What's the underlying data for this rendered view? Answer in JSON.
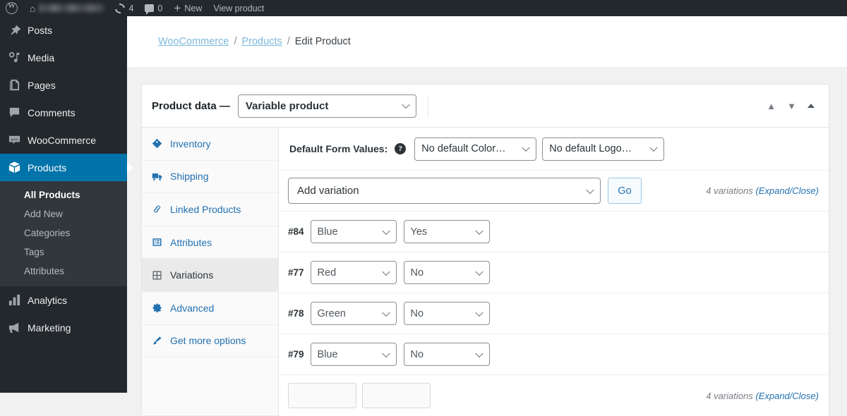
{
  "adminbar": {
    "wp_logo": "wordpress-logo-icon",
    "site_name": "",
    "updates_count": "4",
    "comments_count": "0",
    "new_label": "New",
    "view_product_label": "View product"
  },
  "sidebar": {
    "items": [
      {
        "label": "Posts",
        "icon": "pin-icon",
        "current": false
      },
      {
        "label": "Media",
        "icon": "media-icon",
        "current": false
      },
      {
        "label": "Pages",
        "icon": "pages-icon",
        "current": false
      },
      {
        "label": "Comments",
        "icon": "comment-icon",
        "current": false
      },
      {
        "label": "WooCommerce",
        "icon": "woocommerce-icon",
        "current": false
      },
      {
        "label": "Products",
        "icon": "products-box-icon",
        "current": true
      },
      {
        "label": "Analytics",
        "icon": "chart-bar-icon",
        "current": false
      },
      {
        "label": "Marketing",
        "icon": "megaphone-icon",
        "current": false
      }
    ],
    "products_submenu": [
      {
        "label": "All Products",
        "current": true
      },
      {
        "label": "Add New",
        "current": false
      },
      {
        "label": "Categories",
        "current": false
      },
      {
        "label": "Tags",
        "current": false
      },
      {
        "label": "Attributes",
        "current": false
      }
    ]
  },
  "breadcrumb": {
    "root": "WooCommerce",
    "sep": "/",
    "parent": "Products",
    "current": "Edit Product"
  },
  "panel": {
    "title": "Product data —",
    "product_type": "Variable product",
    "move_up_icon": "chevron-up-icon",
    "move_down_icon": "chevron-down-icon",
    "toggle_icon": "toggle-triangle-icon"
  },
  "tabs": [
    {
      "label": "Inventory",
      "icon": "inventory-tag-icon",
      "active": false
    },
    {
      "label": "Shipping",
      "icon": "truck-icon",
      "active": false
    },
    {
      "label": "Linked Products",
      "icon": "link-icon",
      "active": false
    },
    {
      "label": "Attributes",
      "icon": "attributes-list-icon",
      "active": false
    },
    {
      "label": "Variations",
      "icon": "grid-icon",
      "active": true
    },
    {
      "label": "Advanced",
      "icon": "gear-icon",
      "active": false
    },
    {
      "label": "Get more options",
      "icon": "extension-icon",
      "active": false
    }
  ],
  "variations": {
    "defaults_label": "Default Form Values:",
    "help_tip": "?",
    "default_color": "No default Color…",
    "default_logo": "No default Logo…",
    "add_variation_action": "Add variation",
    "go_label": "Go",
    "count_text": "4 variations",
    "expand_label": "Expand",
    "count_sep": "/",
    "close_label": "Close",
    "paren_open": "(",
    "paren_close": ")",
    "rows": [
      {
        "id": "#84",
        "attr1": "Blue",
        "attr2": "Yes"
      },
      {
        "id": "#77",
        "attr1": "Red",
        "attr2": "No"
      },
      {
        "id": "#78",
        "attr1": "Green",
        "attr2": "No"
      },
      {
        "id": "#79",
        "attr1": "Blue",
        "attr2": "No"
      }
    ],
    "save_label": "",
    "cancel_label": ""
  },
  "colors": {
    "admin_dark": "#23282d",
    "admin_submenu": "#32373c",
    "accent_blue": "#0073aa",
    "link_blue": "#2271b1",
    "page_bg": "#f1f1f1"
  }
}
